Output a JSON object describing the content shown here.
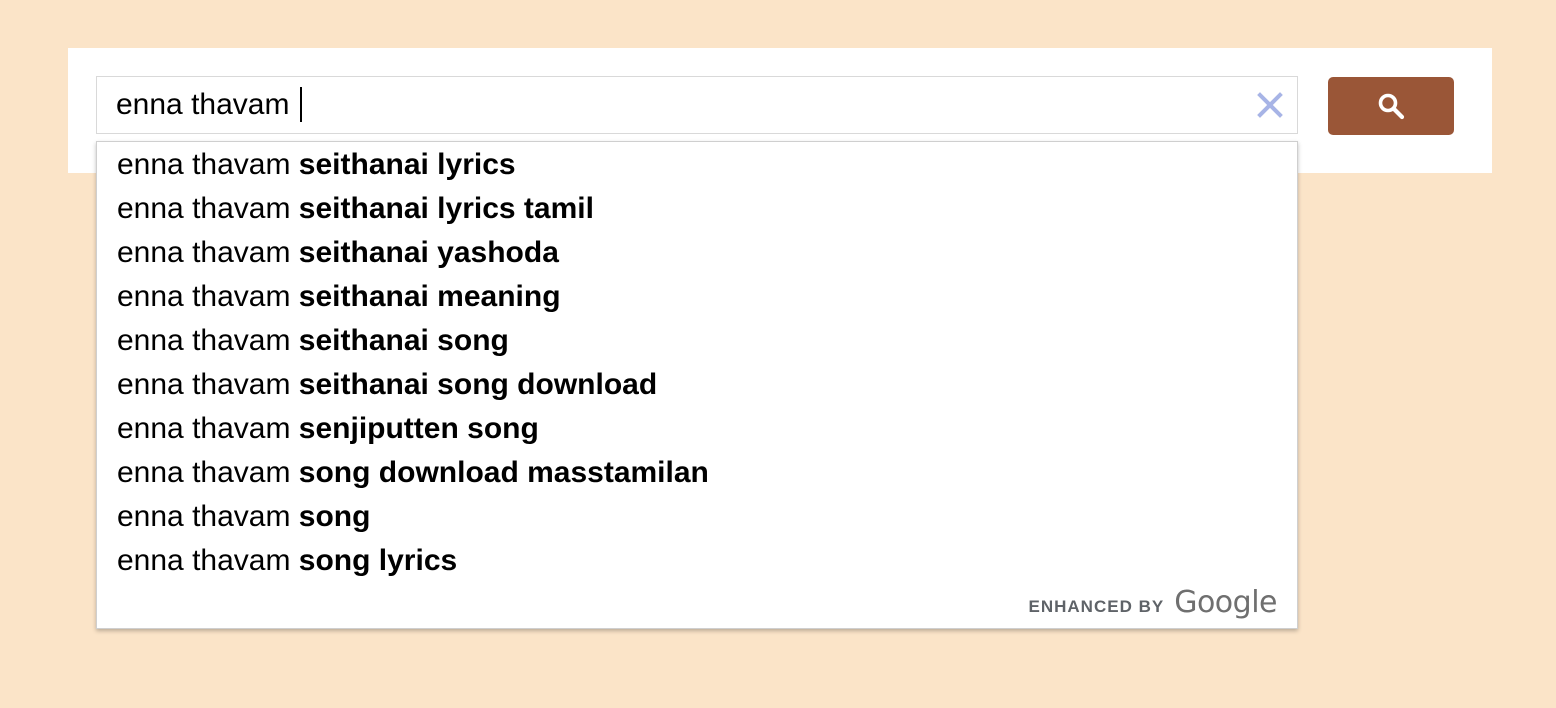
{
  "search": {
    "query": "enna thavam",
    "clear_icon": "close-icon",
    "submit_icon": "search-icon",
    "button_color": "#9a5637"
  },
  "suggestions": [
    {
      "prefix": "enna thavam ",
      "completion": "seithanai lyrics"
    },
    {
      "prefix": "enna thavam ",
      "completion": "seithanai lyrics tamil"
    },
    {
      "prefix": "enna thavam ",
      "completion": "seithanai yashoda"
    },
    {
      "prefix": "enna thavam ",
      "completion": "seithanai meaning"
    },
    {
      "prefix": "enna thavam ",
      "completion": "seithanai song"
    },
    {
      "prefix": "enna thavam ",
      "completion": "seithanai song download"
    },
    {
      "prefix": "enna thavam ",
      "completion": "senjiputten song"
    },
    {
      "prefix": "enna thavam ",
      "completion": "song download masstamilan"
    },
    {
      "prefix": "enna thavam ",
      "completion": "song"
    },
    {
      "prefix": "enna thavam ",
      "completion": "song lyrics"
    }
  ],
  "branding": {
    "label": "ENHANCED BY",
    "logo": "Google"
  },
  "colors": {
    "background": "#fbe4c8",
    "clear_icon": "#a7b4e6"
  }
}
